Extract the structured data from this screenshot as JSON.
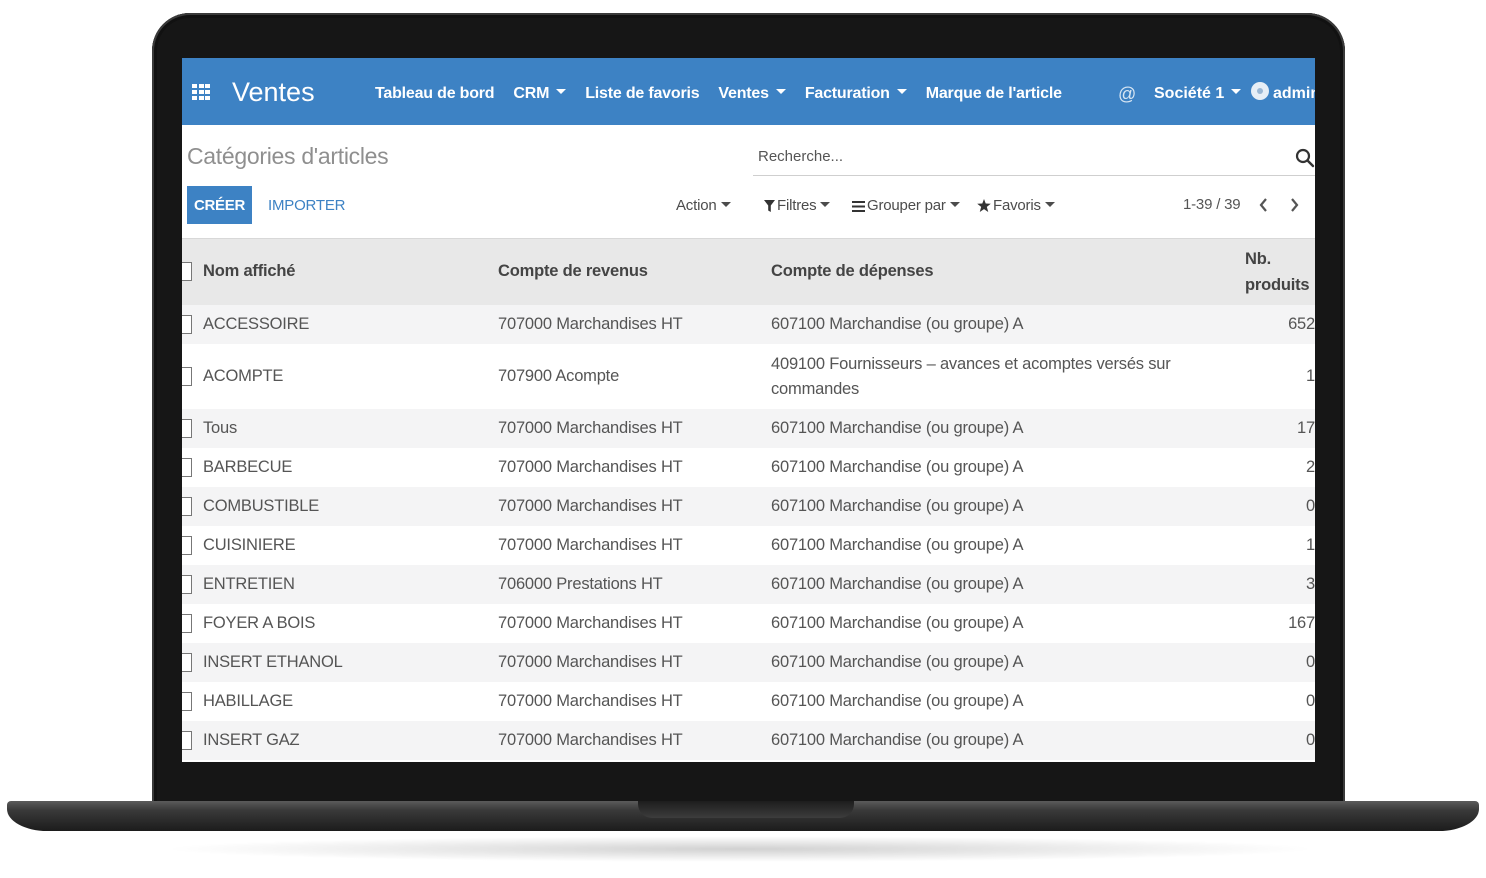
{
  "navbar": {
    "app_title": "Ventes",
    "menu": [
      {
        "label": "Tableau de bord",
        "dropdown": false
      },
      {
        "label": "CRM",
        "dropdown": true
      },
      {
        "label": "Liste de favoris",
        "dropdown": false
      },
      {
        "label": "Ventes",
        "dropdown": true
      },
      {
        "label": "Facturation",
        "dropdown": true
      },
      {
        "label": "Marque de l'article",
        "dropdown": false
      }
    ],
    "at_symbol": "@",
    "company": "Société 1",
    "user": "admin",
    "color": "#3d82c4"
  },
  "control": {
    "breadcrumb": "Catégories d'articles",
    "search_placeholder": "Recherche...",
    "create_label": "CRÉER",
    "import_label": "IMPORTER",
    "action_label": "Action",
    "filters_label": "Filtres",
    "group_by_label": "Grouper par",
    "favorites_label": "Favoris",
    "pager": "1-39 / 39"
  },
  "table": {
    "headers": {
      "name": "Nom affiché",
      "revenue": "Compte de revenus",
      "expense": "Compte de dépenses",
      "nb_products_line1": "Nb.",
      "nb_products_line2": "produits"
    },
    "rows": [
      {
        "name": "ACCESSOIRE",
        "revenue": "707000 Marchandises HT",
        "expense": "607100 Marchandise (ou groupe) A",
        "count": "652"
      },
      {
        "name": "ACOMPTE",
        "revenue": "707900 Acompte",
        "expense": "409100 Fournisseurs – avances et acomptes versés sur commandes",
        "count": "1"
      },
      {
        "name": "Tous",
        "revenue": "707000 Marchandises HT",
        "expense": "607100 Marchandise (ou groupe) A",
        "count": "17"
      },
      {
        "name": "BARBECUE",
        "revenue": "707000 Marchandises HT",
        "expense": "607100 Marchandise (ou groupe) A",
        "count": "2"
      },
      {
        "name": "COMBUSTIBLE",
        "revenue": "707000 Marchandises HT",
        "expense": "607100 Marchandise (ou groupe) A",
        "count": "0"
      },
      {
        "name": "CUISINIERE",
        "revenue": "707000 Marchandises HT",
        "expense": "607100 Marchandise (ou groupe) A",
        "count": "1"
      },
      {
        "name": "ENTRETIEN",
        "revenue": "706000 Prestations HT",
        "expense": "607100 Marchandise (ou groupe) A",
        "count": "3"
      },
      {
        "name": "FOYER A BOIS",
        "revenue": "707000 Marchandises HT",
        "expense": "607100 Marchandise (ou groupe) A",
        "count": "167"
      },
      {
        "name": "INSERT ETHANOL",
        "revenue": "707000 Marchandises HT",
        "expense": "607100 Marchandise (ou groupe) A",
        "count": "0"
      },
      {
        "name": "HABILLAGE",
        "revenue": "707000 Marchandises HT",
        "expense": "607100 Marchandise (ou groupe) A",
        "count": "0"
      },
      {
        "name": "INSERT GAZ",
        "revenue": "707000 Marchandises HT",
        "expense": "607100 Marchandise (ou groupe) A",
        "count": "0"
      }
    ]
  }
}
